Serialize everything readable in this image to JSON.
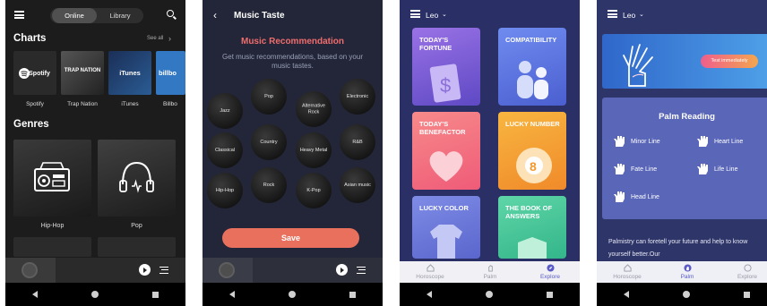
{
  "music_home": {
    "tabs": [
      "Online",
      "Library"
    ],
    "charts_title": "Charts",
    "see_all": "See all",
    "charts": [
      {
        "name": "Spotify",
        "logo": "Spotify",
        "color": "#2b2b2b"
      },
      {
        "name": "Trap Nation",
        "logo": "TRAP NATION",
        "color": "#3b3b3b"
      },
      {
        "name": "iTunes",
        "logo": "iTunes",
        "color": "#1f4575"
      },
      {
        "name": "Billbo",
        "logo": "billbo",
        "color": "#2a6fb0"
      }
    ],
    "genres_title": "Genres",
    "genres": [
      {
        "name": "Hip-Hop",
        "icon": "boombox-icon"
      },
      {
        "name": "Pop",
        "icon": "headphones-icon"
      }
    ]
  },
  "music_taste": {
    "title": "Music Taste",
    "reco_title": "Music Recommendation",
    "reco_desc": "Get music recommendations, based on your music tastes.",
    "genres": [
      "Jazz",
      "Pop",
      "Alternative Rock",
      "Electronic",
      "Classical",
      "Country",
      "Heavy Metal",
      "R&B",
      "Hip-Hop",
      "Rock",
      "K-Pop",
      "Asian music"
    ],
    "save": "Save"
  },
  "horoscope_explore": {
    "sign": "Leo",
    "cards": [
      {
        "title": "TODAY'S FORTUNE",
        "bg": "#7a5fd6"
      },
      {
        "title": "COMPATIBILITY",
        "bg": "#5576e0"
      },
      {
        "title": "TODAY'S BENEFACTOR",
        "bg": "#f26d78"
      },
      {
        "title": "LUCKY NUMBER",
        "bg": "#f6a032"
      },
      {
        "title": "LUCKY COLOR",
        "bg": "#6a78d8"
      },
      {
        "title": "THE BOOK OF ANSWERS",
        "bg": "#3fbf90"
      }
    ],
    "tabs": [
      "Horoscope",
      "Palm",
      "Explore"
    ],
    "active_tab": "Explore"
  },
  "palm": {
    "sign": "Leo",
    "test_button": "Test immediately",
    "reading_title": "Palm Reading",
    "lines": [
      "Minor Line",
      "Heart Line",
      "Fate Line",
      "Life Line",
      "Head Line"
    ],
    "text": "Palmistry can foretell your future and help to know yourself better.Our",
    "tabs": [
      "Horoscope",
      "Palm",
      "Explore"
    ],
    "active_tab": "Palm"
  }
}
